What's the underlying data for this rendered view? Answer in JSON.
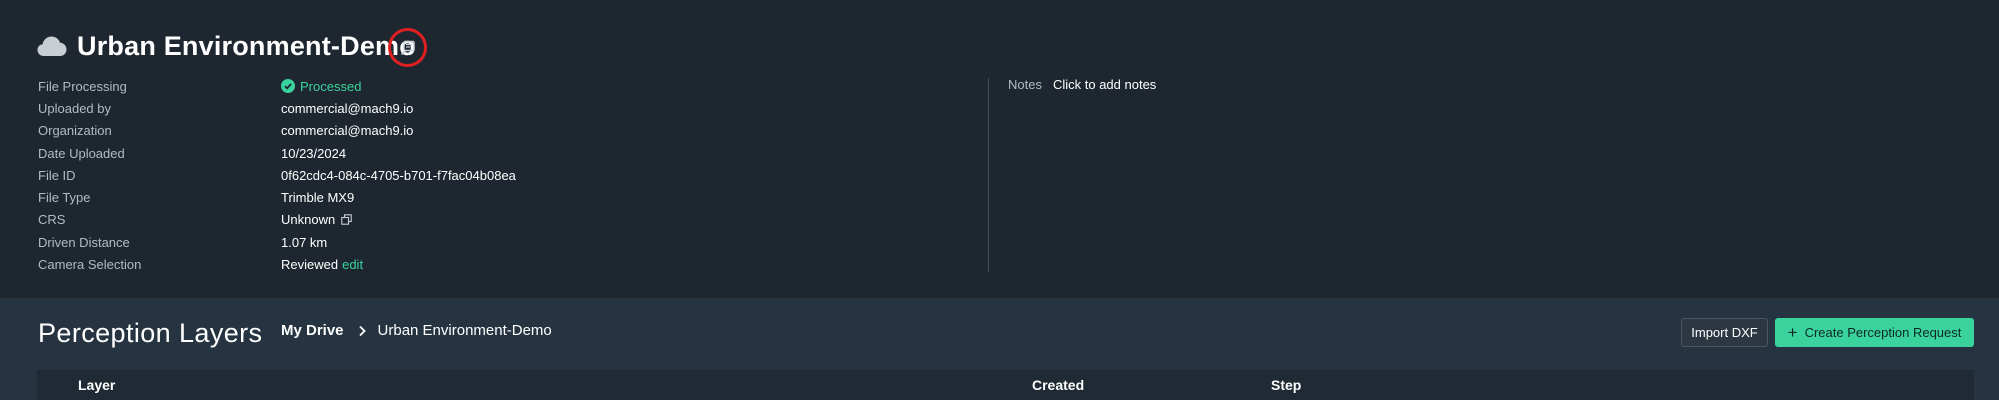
{
  "header": {
    "title": "Urban Environment-Demo",
    "icons": {
      "cloud": "cloud-icon",
      "edit": "edit-title-icon"
    }
  },
  "details": [
    {
      "label": "File Processing",
      "value": "Processed",
      "status": "success"
    },
    {
      "label": "Uploaded by",
      "value": "commercial@mach9.io"
    },
    {
      "label": "Organization",
      "value": "commercial@mach9.io"
    },
    {
      "label": "Date Uploaded",
      "value": "10/23/2024"
    },
    {
      "label": "File ID",
      "value": "0f62cdc4-084c-4705-b701-f7fac04b08ea"
    },
    {
      "label": "File Type",
      "value": "Trimble MX9"
    },
    {
      "label": "CRS",
      "value": "Unknown"
    },
    {
      "label": "Driven Distance",
      "value": "1.07 km"
    },
    {
      "label": "Camera Selection",
      "value": "Reviewed",
      "link": "edit"
    }
  ],
  "notes": {
    "label": "Notes",
    "value": "Click to add notes"
  },
  "perception": {
    "title": "Perception Layers",
    "breadcrumb": {
      "root": "My Drive",
      "current": "Urban Environment-Demo"
    },
    "import_label": "Import DXF",
    "create_label": "Create Perception Request",
    "columns": [
      "Layer",
      "Created",
      "Step"
    ]
  },
  "colors": {
    "accent": "#3ad39e",
    "background": "#1e2730",
    "section_background": "#253440",
    "highlight_circle": "#e02020"
  }
}
